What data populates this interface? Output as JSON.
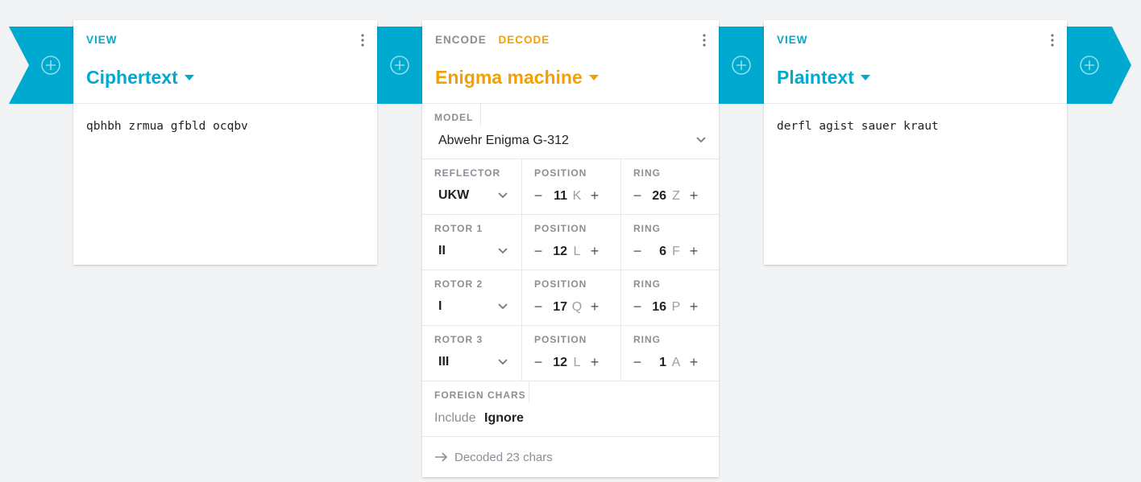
{
  "pipeline": {
    "add_buttons": [
      "add",
      "add",
      "add",
      "add"
    ]
  },
  "cards": {
    "ciphertext": {
      "tab_view": "VIEW",
      "title": "Ciphertext",
      "content": "qbhbh zrmua gfbld ocqbv"
    },
    "enigma": {
      "tab_encode": "ENCODE",
      "tab_decode": "DECODE",
      "title": "Enigma machine",
      "model": {
        "label": "MODEL",
        "value": "Abwehr Enigma G-312"
      },
      "rows": [
        {
          "name_label": "REFLECTOR",
          "name_value": "UKW",
          "pos_label": "POSITION",
          "pos_num": "11",
          "pos_letter": "K",
          "ring_label": "RING",
          "ring_num": "26",
          "ring_letter": "Z"
        },
        {
          "name_label": "ROTOR 1",
          "name_value": "II",
          "pos_label": "POSITION",
          "pos_num": "12",
          "pos_letter": "L",
          "ring_label": "RING",
          "ring_num": "6",
          "ring_letter": "F"
        },
        {
          "name_label": "ROTOR 2",
          "name_value": "I",
          "pos_label": "POSITION",
          "pos_num": "17",
          "pos_letter": "Q",
          "ring_label": "RING",
          "ring_num": "16",
          "ring_letter": "P"
        },
        {
          "name_label": "ROTOR 3",
          "name_value": "III",
          "pos_label": "POSITION",
          "pos_num": "12",
          "pos_letter": "L",
          "ring_label": "RING",
          "ring_num": "1",
          "ring_letter": "A"
        }
      ],
      "foreign": {
        "label": "FOREIGN CHARS",
        "opt_include": "Include",
        "opt_ignore": "Ignore"
      },
      "status": "Decoded 23 chars",
      "steppers": {
        "minus": "−",
        "plus": "+"
      }
    },
    "plaintext": {
      "tab_view": "VIEW",
      "title": "Plaintext",
      "content": "derfl agist sauer kraut"
    }
  },
  "colors": {
    "accent": "#00a9cf",
    "orange": "#f5a000",
    "muted": "#8a8f95",
    "background": "#f2f3f5"
  },
  "icons": [
    "add-circle-icon",
    "caret-down-icon",
    "more-vert-icon",
    "chevron-down-icon",
    "arrow-right-icon"
  ]
}
